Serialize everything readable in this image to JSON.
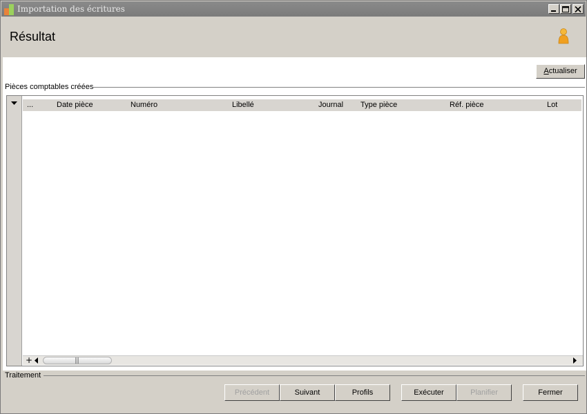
{
  "window": {
    "title": "Importation des écritures"
  },
  "header": {
    "title": "Résultat"
  },
  "toolbar": {
    "refresh_label": "Actualiser"
  },
  "group": {
    "label": "Pièces comptables créées"
  },
  "grid": {
    "columns": [
      "...",
      "Date pièce",
      "Numéro",
      "Libellé",
      "Journal",
      "Type pièce",
      "Réf. pièce",
      "Lot"
    ],
    "rows": [],
    "scroll_grip": "|||"
  },
  "footer_group": {
    "label": "Traitement"
  },
  "buttons": {
    "previous": "Précédent",
    "next": "Suivant",
    "profiles": "Profils",
    "execute": "Exécuter",
    "schedule": "Planifier",
    "close": "Fermer"
  },
  "colors": {
    "titlebar": "#7b7b7b",
    "window_bg": "#d4d0c8",
    "person_icon": "#f0a020"
  }
}
